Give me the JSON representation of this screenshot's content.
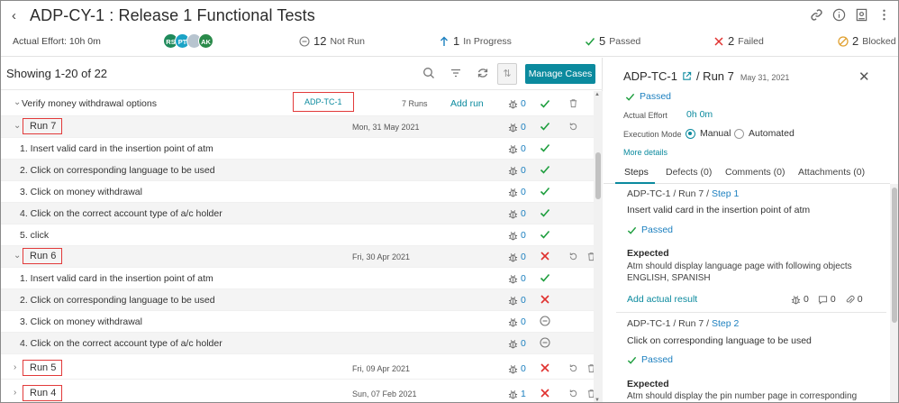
{
  "header": {
    "title": "ADP-CY-1 : Release 1 Functional Tests",
    "effort": "Actual Effort: 10h 0m",
    "avatars": [
      {
        "initials": "RS",
        "color": "#1f8a5b"
      },
      {
        "initials": "PT",
        "color": "#1ba3c6"
      },
      {
        "initials": "",
        "color": "#b7c4cf"
      },
      {
        "initials": "AK",
        "color": "#2a8a4a"
      }
    ],
    "stats": {
      "not_run_num": "12",
      "not_run_label": "Not Run",
      "in_progress_num": "1",
      "in_progress_label": "In Progress",
      "passed_num": "5",
      "passed_label": "Passed",
      "failed_num": "2",
      "failed_label": "Failed",
      "blocked_num": "2",
      "blocked_label": "Blocked"
    }
  },
  "left": {
    "showing": "Showing 1-20 of 22",
    "manage_label": "Manage Cases",
    "testcase": {
      "title": "Verify money withdrawal options",
      "id": "ADP-TC-1",
      "runs": "7 Runs",
      "add_run": "Add run",
      "defects": "0"
    },
    "run7": {
      "label": "Run 7",
      "date": "Mon, 31 May 2021",
      "defects": "0"
    },
    "run7_steps": [
      {
        "text": "1.  Insert valid card in the insertion point of atm",
        "defects": "0"
      },
      {
        "text": "2.  Click on corresponding language to be used",
        "defects": "0"
      },
      {
        "text": "3.  Click on money withdrawal",
        "defects": "0"
      },
      {
        "text": "4.  Click on the correct account type of a/c holder",
        "defects": "0"
      },
      {
        "text": "5.  click",
        "defects": "0"
      }
    ],
    "run6": {
      "label": "Run 6",
      "date": "Fri, 30 Apr 2021",
      "defects": "0"
    },
    "run6_steps": [
      {
        "text": "1.  Insert valid card in the insertion point of atm",
        "defects": "0"
      },
      {
        "text": "2.  Click on corresponding language to be used",
        "defects": "0"
      },
      {
        "text": "3.  Click on money withdrawal",
        "defects": "0"
      },
      {
        "text": "4.  Click on the correct account type of a/c holder",
        "defects": "0"
      }
    ],
    "run5": {
      "label": "Run 5",
      "date": "Fri, 09 Apr 2021",
      "defects": "0"
    },
    "run4": {
      "label": "Run 4",
      "date": "Sun, 07 Feb 2021",
      "defects": "1"
    }
  },
  "right": {
    "tc_id": "ADP-TC-1",
    "run_label": "/ Run 7",
    "date": "May 31, 2021",
    "status": "Passed",
    "effort_label": "Actual Effort",
    "effort_value": "0h 0m",
    "mode_label": "Execution Mode",
    "mode_manual": "Manual",
    "mode_auto": "Automated",
    "more": "More details",
    "tabs": [
      "Steps",
      "Defects (0)",
      "Comments (0)",
      "Attachments (0)"
    ],
    "step1": {
      "crumb": "ADP-TC-1 / Run 7 / ",
      "step": "Step 1",
      "desc": "Insert valid card in the insertion point of atm",
      "status": "Passed",
      "expected_h": "Expected",
      "expected_1": "Atm should display language page with following objects",
      "expected_2": "ENGLISH, SPANISH",
      "add_actual": "Add actual result",
      "defects": "0",
      "comments": "0",
      "attachments": "0"
    },
    "step2": {
      "crumb": "ADP-TC-1 / Run 7 / ",
      "step": "Step 2",
      "desc": "Click on corresponding language to be used",
      "status": "Passed",
      "expected_h": "Expected",
      "expected_1": "Atm should display the pin number page in corresponding"
    }
  },
  "colors": {
    "accent": "#0b8a9e",
    "link": "#1b7fbf",
    "pass": "#1e9e3e",
    "fail": "#e0312f",
    "blocked": "#e0a030",
    "highlight": "#e23a3a"
  }
}
